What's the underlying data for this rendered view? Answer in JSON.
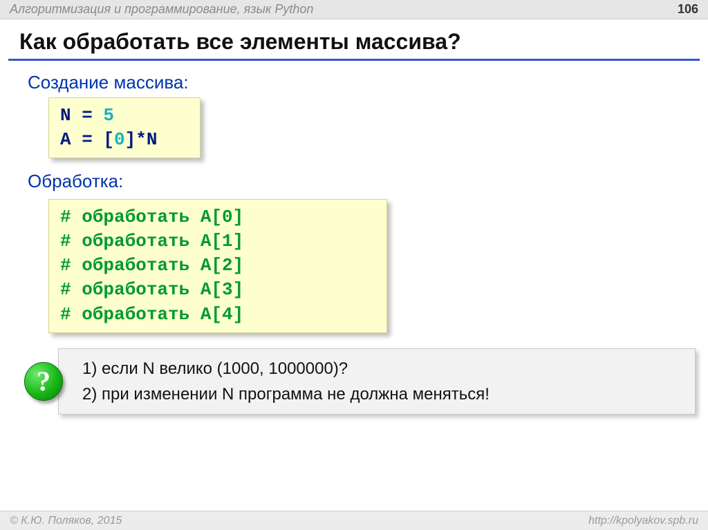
{
  "header": {
    "subject": "Алгоритмизация и программирование, язык Python",
    "page": "106"
  },
  "title": "Как обработать все элементы массива?",
  "sections": {
    "create_label": "Создание массива:",
    "process_label": "Обработка:"
  },
  "code1": {
    "l1a": "N",
    "l1b": " = ",
    "l1c": "5",
    "l2a": "A",
    "l2b": " = [",
    "l2c": "0",
    "l2d": "]*N"
  },
  "code2": {
    "c0": "# обработать A[0]",
    "c1": "# обработать A[1]",
    "c2": "# обработать A[2]",
    "c3": "# обработать A[3]",
    "c4": "# обработать A[4]"
  },
  "question": {
    "mark": "?",
    "q1": "1) если N велико (1000, 1000000)?",
    "q2": "2) при изменении N программа не должна меняться!"
  },
  "footer": {
    "left": "© К.Ю. Поляков, 2015",
    "right": "http://kpolyakov.spb.ru"
  }
}
